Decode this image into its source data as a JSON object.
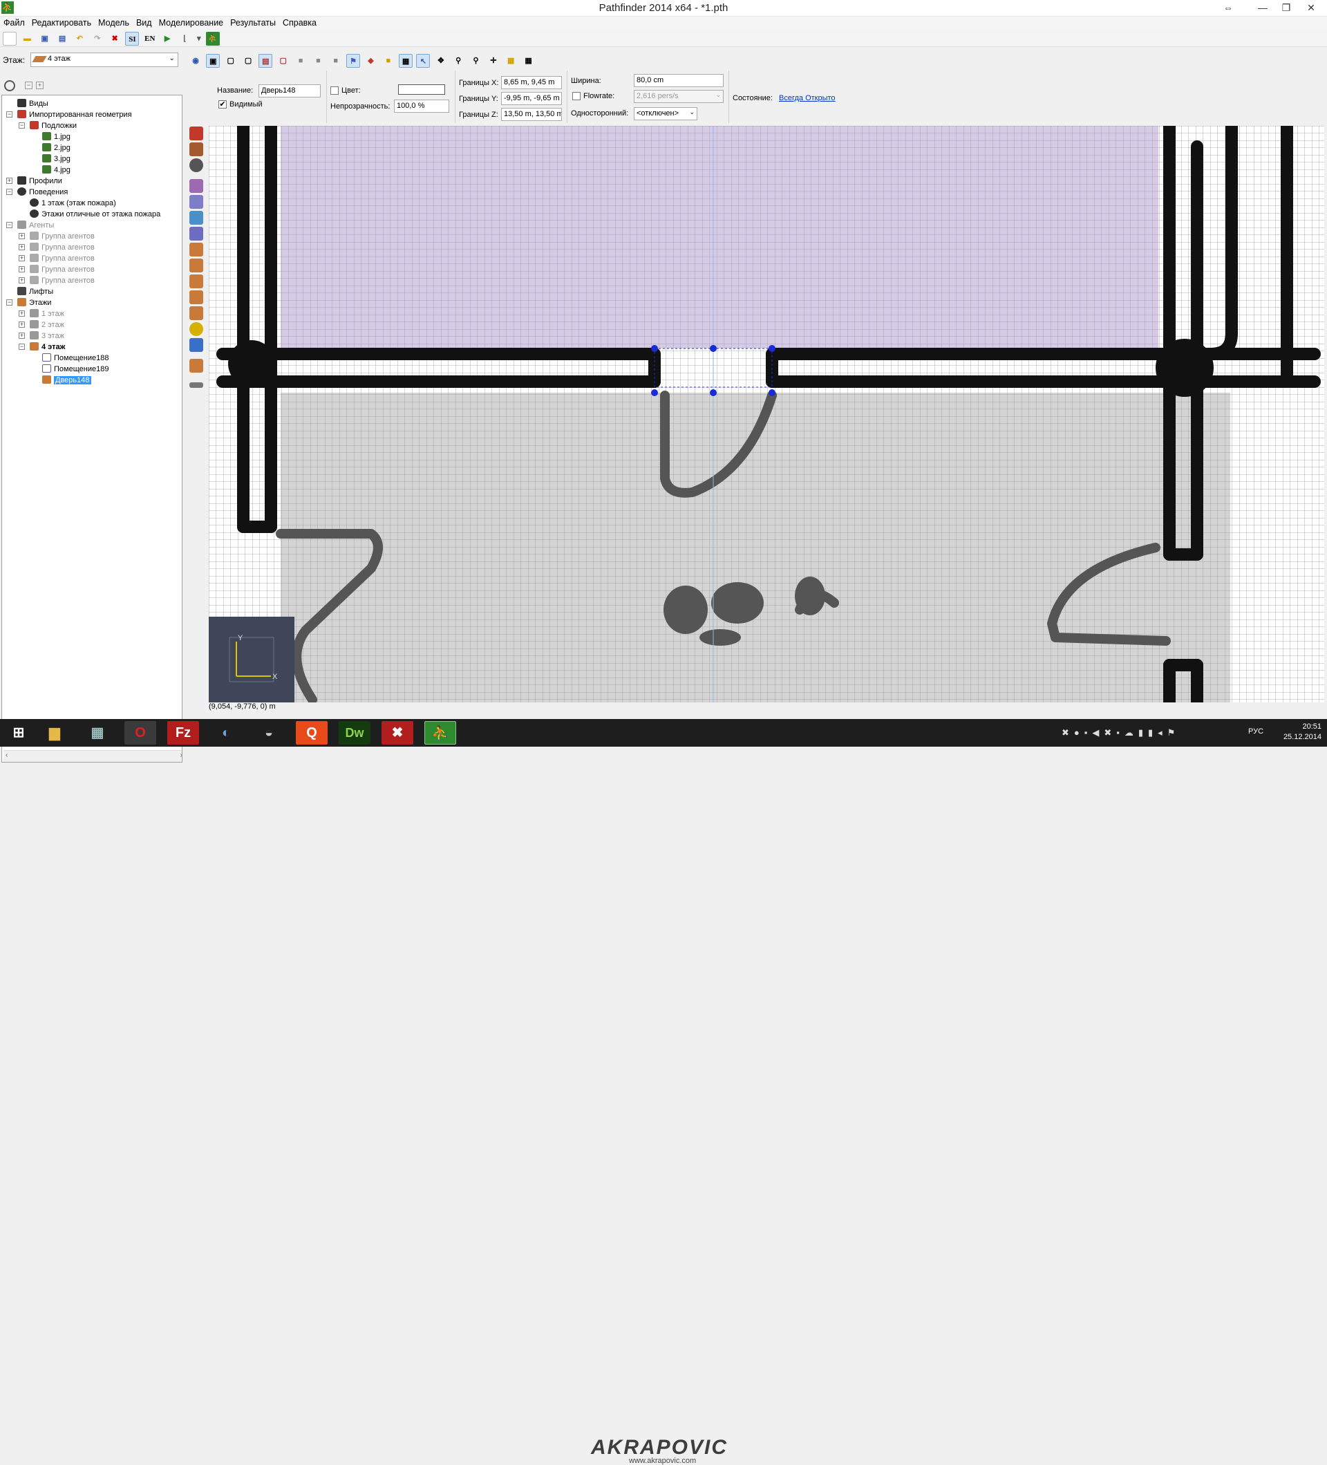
{
  "window": {
    "title": "Pathfinder 2014 x64 - *1.pth",
    "app_icon": "pathfinder-logo"
  },
  "menu": [
    "Файл",
    "Редактировать",
    "Модель",
    "Вид",
    "Моделирование",
    "Результаты",
    "Справка"
  ],
  "toolbar1": {
    "si_label": "SI",
    "en_label": "EN"
  },
  "floor_selector": {
    "label": "Этаж:",
    "value": "4 этаж"
  },
  "tree": {
    "views": "Виды",
    "imported_geometry": "Импортированная геометрия",
    "underlays": "Подложки",
    "underlay_files": [
      "1.jpg",
      "2.jpg",
      "3.jpg",
      "4.jpg"
    ],
    "profiles": "Профили",
    "behaviors": "Поведения",
    "behavior_items": [
      "1 этаж (этаж пожара)",
      "Этажи отличные от этажа пожара"
    ],
    "agents": "Агенты",
    "agent_groups": [
      "Группа агентов",
      "Группа агентов",
      "Группа агентов",
      "Группа агентов",
      "Группа агентов"
    ],
    "elevators": "Лифты",
    "floors": "Этажи",
    "floor_items": [
      "1 этаж",
      "2 этаж",
      "3 этаж",
      "4 этаж"
    ],
    "rooms": [
      "Помещение188",
      "Помещение189"
    ],
    "selected_door": "Дверь148"
  },
  "properties": {
    "name_label": "Название:",
    "name_value": "Дверь148",
    "visible_label": "Видимый",
    "color_label": "Цвет:",
    "opacity_label": "Непрозрачность:",
    "opacity_value": "100,0 %",
    "bounds_x_label": "Границы X:",
    "bounds_x_value": "8,65 m, 9,45 m",
    "bounds_y_label": "Границы Y:",
    "bounds_y_value": "-9,95 m, -9,65 m",
    "bounds_z_label": "Границы Z:",
    "bounds_z_value": "13,50 m, 13,50 m",
    "width_label": "Ширина:",
    "width_value": "80,0 cm",
    "flowrate_label": "Flowrate:",
    "flowrate_value": "2,616 pers/s",
    "oneway_label": "Односторонний:",
    "oneway_value": "<отключен>",
    "state_label": "Состояние:",
    "state_value": "Всегда Открыто"
  },
  "canvas": {
    "coordinate_readout": "(9,054, -9,776, 0) m",
    "axis_y": "Y",
    "axis_x": "X"
  },
  "taskbar": {
    "apps": [
      "start-icon",
      "file-explorer-icon",
      "calculator-icon",
      "opera-icon",
      "filezilla-icon",
      "chrome-icon",
      "mascot-icon",
      "qip-icon",
      "dreamweaver-icon",
      "xara-icon",
      "pathfinder-icon"
    ],
    "dw_label": "Dw",
    "fz_label": "Fz",
    "lang": "РУС",
    "time": "20:51",
    "date": "25.12.2014",
    "watermark": "AKRAPOVIC",
    "watermark_url": "www.akrapovic.com"
  },
  "colors": {
    "room_purple": "#d6cbe6",
    "room_grey": "#d4d4d4",
    "grid_line": "#9a9a9a",
    "wall": "#111111",
    "selection": "#3399ff",
    "handle": "#1a2bd6"
  }
}
